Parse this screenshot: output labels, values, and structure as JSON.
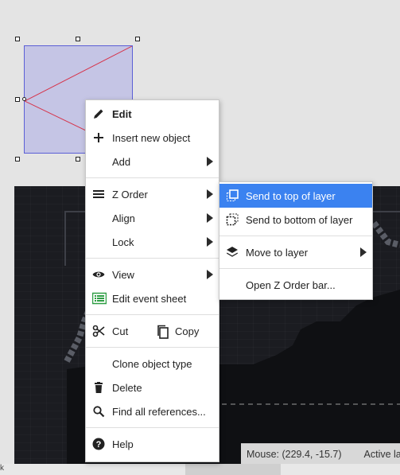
{
  "context_menu": {
    "items": {
      "edit": "Edit",
      "insert_new_object": "Insert new object",
      "add": "Add",
      "z_order": "Z Order",
      "align": "Align",
      "lock": "Lock",
      "view": "View",
      "edit_event_sheet": "Edit event sheet",
      "cut": "Cut",
      "copy": "Copy",
      "clone_object_type": "Clone object type",
      "delete": "Delete",
      "find_all_references": "Find all references...",
      "help": "Help"
    }
  },
  "z_order_submenu": {
    "items": {
      "send_to_top": "Send to top of layer",
      "send_to_bottom": "Send to bottom of layer",
      "move_to_layer": "Move to layer",
      "open_z_order_bar": "Open Z Order bar..."
    }
  },
  "status_bar": {
    "mouse": "Mouse: (229.4, -15.7)",
    "active_layer": "Active la"
  },
  "left_edge_glyph": "k",
  "colors": {
    "menu_highlight": "#3b82f0",
    "selection_fill": "#a0a0e6",
    "selection_border": "#5b5fd6",
    "event_sheet_icon": "#2e9e44",
    "level_background": "#1b1c21"
  },
  "icons": {
    "edit": "pencil-icon",
    "insert": "plus-icon",
    "z_order": "list-icon",
    "view": "eye-icon",
    "edit_event_sheet": "event-sheet-icon",
    "cut": "scissors-icon",
    "copy": "copy-icon",
    "delete": "trash-icon",
    "find": "search-icon",
    "help": "help-icon",
    "send_to_top": "bring-front-icon",
    "send_to_bottom": "send-back-icon",
    "move_to_layer": "layers-icon"
  }
}
